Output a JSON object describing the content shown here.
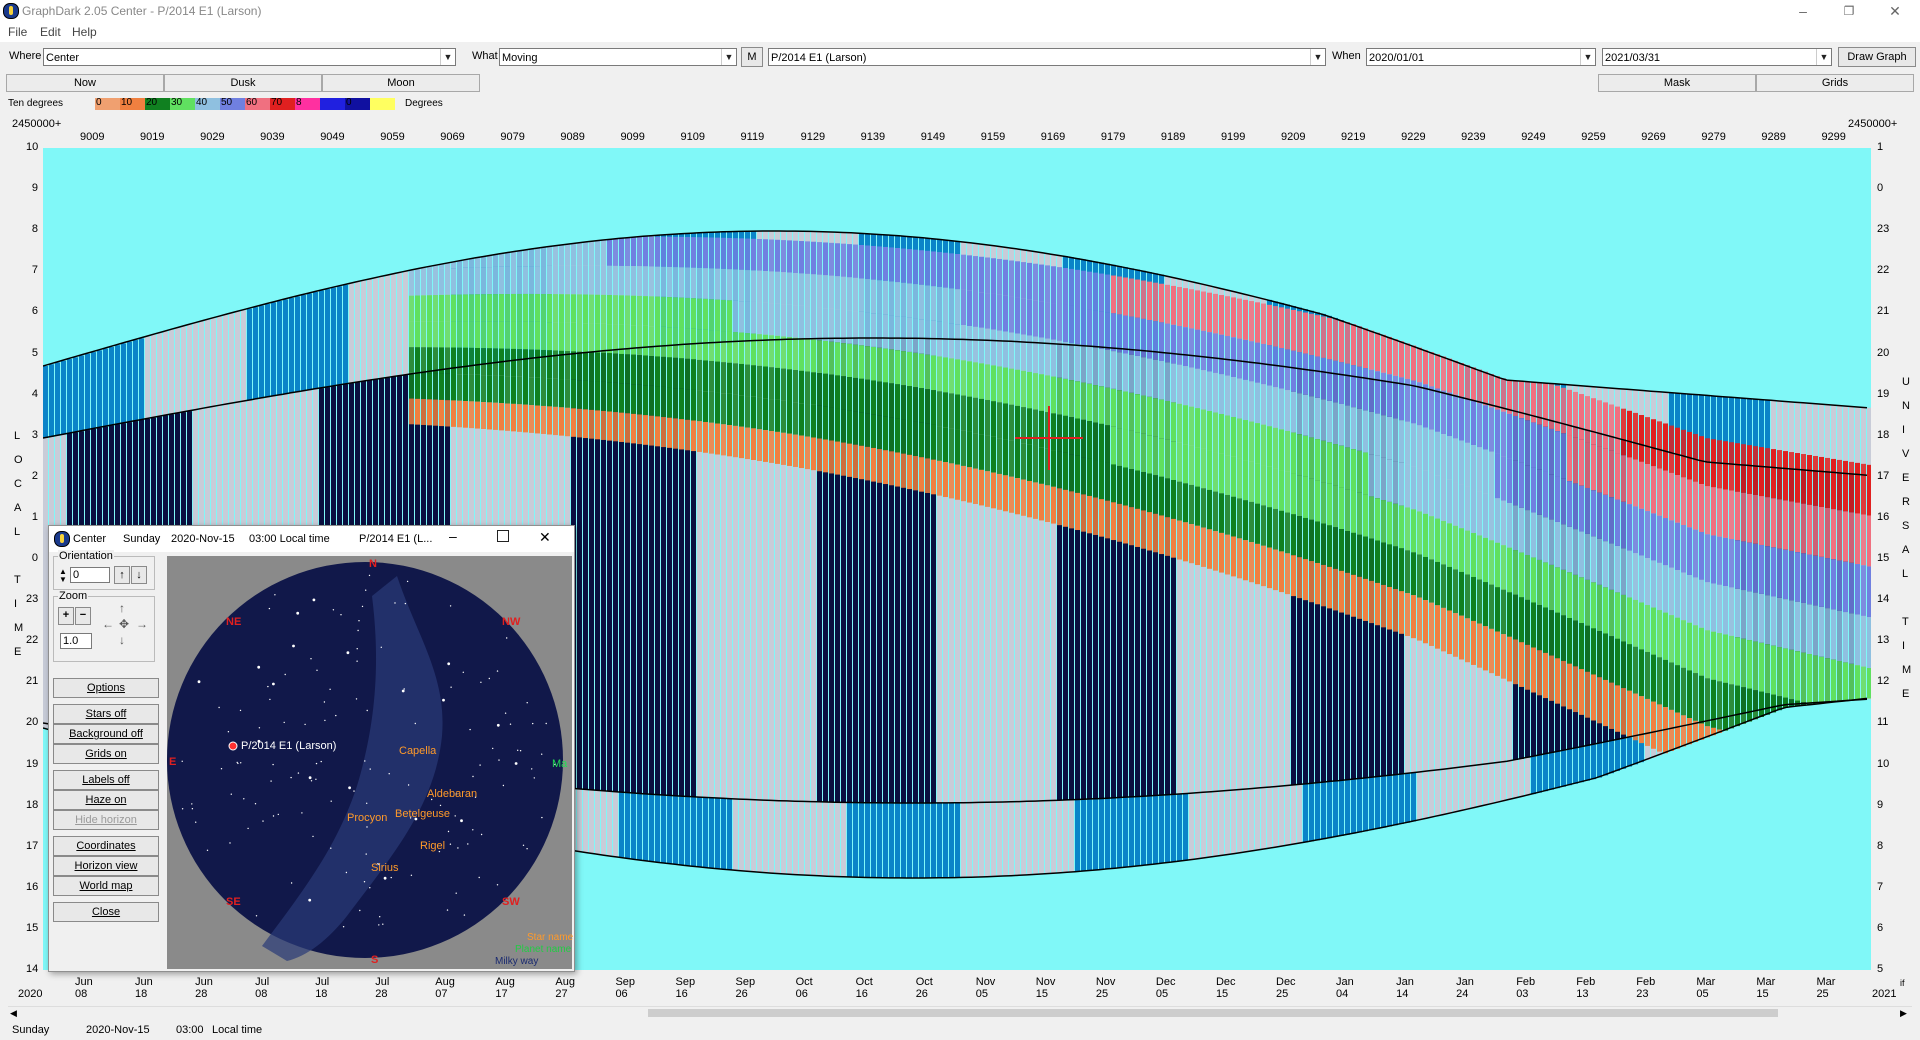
{
  "window": {
    "title": "GraphDark 2.05  Center  -  P/2014 E1 (Larson)",
    "minimize_label": "–",
    "maximize_label": "❐",
    "close_label": "✕"
  },
  "menu": [
    "File",
    "Edit",
    "Help"
  ],
  "toolbar": {
    "where_label": "Where",
    "where_value": "Center",
    "what_label": "What",
    "what_value": "Moving",
    "m_button": "M",
    "object_value": "P/2014 E1 (Larson)",
    "when_label": "When",
    "start_date": "2020/01/01",
    "end_date": "2021/03/31",
    "draw_button": "Draw Graph"
  },
  "quick_buttons": {
    "now": "Now",
    "dusk": "Dusk",
    "moon": "Moon",
    "mask": "Mask",
    "grids": "Grids"
  },
  "legend": {
    "label": "Ten degrees",
    "units": "Degrees",
    "scale": [
      {
        "value": "0",
        "color": "#f0a070"
      },
      {
        "value": "10",
        "color": "#f08040"
      },
      {
        "value": "20",
        "color": "#108020"
      },
      {
        "value": "30",
        "color": "#60e060"
      },
      {
        "value": "40",
        "color": "#8fc0e0"
      },
      {
        "value": "50",
        "color": "#7080e0"
      },
      {
        "value": "60",
        "color": "#f07080"
      },
      {
        "value": "70",
        "color": "#e02020"
      },
      {
        "value": "8",
        "color": "#ff30a0"
      },
      {
        "value": "",
        "color": "#2020e0"
      },
      {
        "value": "0",
        "color": "#1010a0"
      },
      {
        "value": "",
        "color": "#ffff60"
      }
    ]
  },
  "graph": {
    "jd_prefix_left": "2450000+",
    "jd_prefix_right": "2450000+",
    "jd_ticks": [
      "9009",
      "9019",
      "9029",
      "9039",
      "9049",
      "9059",
      "9069",
      "9079",
      "9089",
      "9099",
      "9109",
      "9119",
      "9129",
      "9139",
      "9149",
      "9159",
      "9169",
      "9179",
      "9189",
      "9199",
      "9209",
      "9219",
      "9229",
      "9239",
      "9249",
      "9259",
      "9269",
      "9279",
      "9289",
      "9299"
    ],
    "local_time_ticks": [
      "10",
      "9",
      "8",
      "7",
      "6",
      "5",
      "4",
      "3",
      "2",
      "1",
      "0",
      "23",
      "22",
      "21",
      "20",
      "19",
      "18",
      "17",
      "16",
      "15",
      "14"
    ],
    "universal_time_ticks": [
      "1",
      "0",
      "23",
      "22",
      "21",
      "20",
      "19",
      "18",
      "17",
      "16",
      "15",
      "14",
      "13",
      "12",
      "11",
      "10",
      "9",
      "8",
      "7",
      "6",
      "5"
    ],
    "left_axis_title": [
      "L",
      "O",
      "C",
      "A",
      "L",
      "",
      "T",
      "I",
      "M",
      "E"
    ],
    "right_axis_title": [
      "U",
      "N",
      "I",
      "V",
      "E",
      "R",
      "S",
      "A",
      "L",
      "",
      "T",
      "I",
      "M",
      "E"
    ],
    "date_ticks": [
      "Jun 08",
      "Jun 18",
      "Jun 28",
      "Jul 08",
      "Jul 18",
      "Jul 28",
      "Aug 07",
      "Aug 17",
      "Aug 27",
      "Sep 06",
      "Sep 16",
      "Sep 26",
      "Oct 06",
      "Oct 16",
      "Oct 26",
      "Nov 05",
      "Nov 15",
      "Nov 25",
      "Dec 05",
      "Dec 15",
      "Dec 25",
      "Jan 04",
      "Jan 14",
      "Jan 24",
      "Feb 03",
      "Feb 13",
      "Feb 23",
      "Mar 05",
      "Mar 15",
      "Mar 25"
    ],
    "year_left": "2020",
    "year_right": "2021",
    "corner_right": "if",
    "background_color": "#80f8f8",
    "night_color": "#0a0f40"
  },
  "status": {
    "day": "Sunday",
    "date": "2020-Nov-15",
    "time": "03:00",
    "time_label": "Local time"
  },
  "popup": {
    "title_app": "Center",
    "title_day": "Sunday",
    "title_date": "2020-Nov-15",
    "title_time": "03:00 Local time",
    "title_object": "P/2014 E1 (L...",
    "orientation_label": "Orientation",
    "orientation_value": "0",
    "zoom_label": "Zoom",
    "zoom_value": "1.0",
    "buttons": [
      {
        "label": "Options",
        "disabled": false
      },
      {
        "label": "Stars off",
        "disabled": false
      },
      {
        "label": "Background off",
        "disabled": false
      },
      {
        "label": "Grids on",
        "disabled": false
      },
      {
        "label": "Labels off",
        "disabled": false
      },
      {
        "label": "Haze on",
        "disabled": false
      },
      {
        "label": "Hide horizon",
        "disabled": true
      },
      {
        "label": "Coordinates",
        "disabled": false
      },
      {
        "label": "Horizon view",
        "disabled": false
      },
      {
        "label": "World map",
        "disabled": false
      },
      {
        "label": "Close",
        "disabled": false
      }
    ],
    "sky": {
      "directions": {
        "n": "N",
        "ne": "NE",
        "nw": "NW",
        "e": "E",
        "w": "W",
        "se": "SE",
        "sw": "SW",
        "s": "S"
      },
      "object_label": "P/2014 E1 (Larson)",
      "stars": [
        "Capella",
        "Aldebaran",
        "Betelgeuse",
        "Procyon",
        "Rigel",
        "Sirius"
      ],
      "planet_label": "Ma",
      "key_star": "Star name",
      "key_planet": "Planet name",
      "key_milky": "Milky way"
    }
  }
}
